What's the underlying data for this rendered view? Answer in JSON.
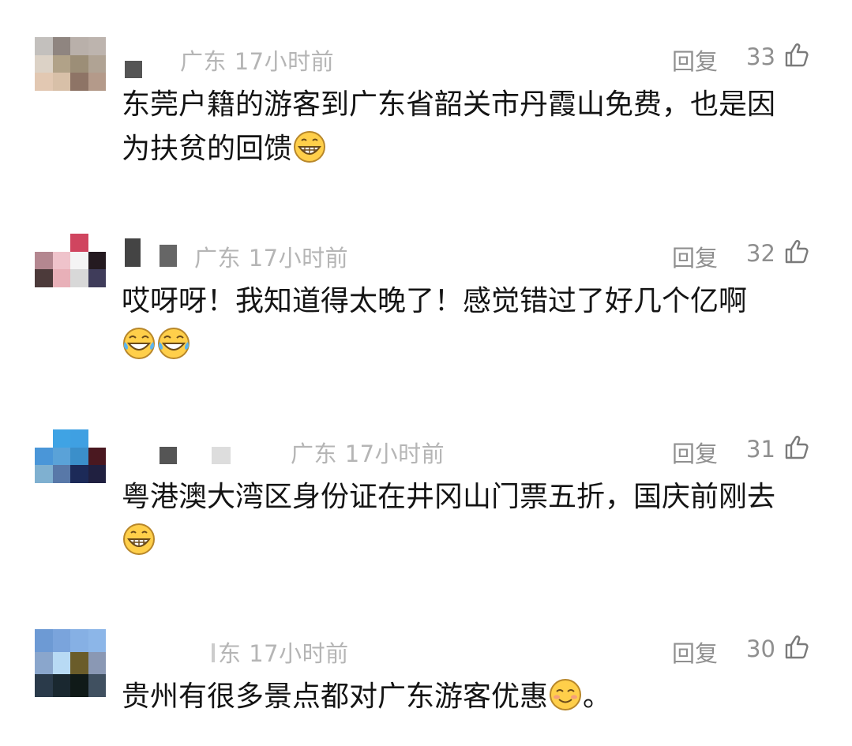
{
  "comments": [
    {
      "location_time": "广东 17小时前",
      "reply_label": "回复",
      "likes": "33",
      "text": "东莞户籍的游客到广东省韶关市丹霞山免费，也是因为扶贫的回馈",
      "emojis": [
        "grin-emoji"
      ],
      "avatar_colors": [
        "#c3c0bd",
        "#8f8580",
        "#b9b0aa",
        "#bdb4ae",
        "#dcd2c6",
        "#b1a288",
        "#9c8e77",
        "#b0a394",
        "#e2c8b2",
        "#d8c0a8",
        "#8e7466",
        "#b49a8a"
      ]
    },
    {
      "location_time": "广东 17小时前",
      "reply_label": "回复",
      "likes": "32",
      "text": "哎呀呀！我知道得太晚了！感觉错过了好几个亿啊",
      "emojis": [
        "tears-of-joy-emoji",
        "tears-of-joy-emoji"
      ],
      "avatar_colors": [
        "#ffffff",
        "#ffffff",
        "#d0455f",
        "#ffffff",
        "#b48790",
        "#efc3cb",
        "#f4f4f4",
        "#241a20",
        "#4c3a3a",
        "#e8b0b8",
        "#d8d8d8",
        "#3f3c5a"
      ]
    },
    {
      "location_time": "广东 17小时前",
      "reply_label": "回复",
      "likes": "31",
      "text": "粤港澳大湾区身份证在井冈山门票五折，国庆前刚去",
      "emojis": [
        "grin-emoji"
      ],
      "avatar_colors": [
        "#ffffff",
        "#3fa3e4",
        "#3fa0e2",
        "#ffffff",
        "#4a96d8",
        "#5aa2d8",
        "#3b8fca",
        "#4a1820",
        "#7fb0d0",
        "#5878a8",
        "#1c2a58",
        "#202040"
      ]
    },
    {
      "location_time": "东 17小时前",
      "reply_label": "回复",
      "likes": "30",
      "text": "贵州有很多景点都对广东游客优惠",
      "emojis": [
        "smile-emoji"
      ],
      "trailing": "。",
      "avatar_colors": [
        "#6d9ad4",
        "#7aa4dc",
        "#86b0e4",
        "#8cb6e8",
        "#8aa6cc",
        "#b8daf4",
        "#6a5c2a",
        "#8a98b4",
        "#2a3a4a",
        "#1a2830",
        "#101a18",
        "#405060"
      ]
    }
  ]
}
